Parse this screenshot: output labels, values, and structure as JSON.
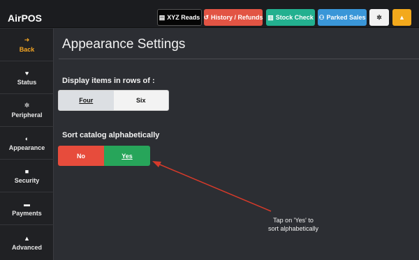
{
  "app": {
    "title": "AirPOS"
  },
  "toolbar": {
    "xyz": "XYZ Reads",
    "history": "History / Refunds",
    "stock": "Stock Check",
    "parked": "Parked Sales"
  },
  "sidebar": {
    "items": [
      {
        "label": "Back",
        "icon": "back-arrow-icon"
      },
      {
        "label": "Status",
        "icon": "heartbeat-icon"
      },
      {
        "label": "Peripheral",
        "icon": "gear-icon"
      },
      {
        "label": "Appearance",
        "icon": "contrast-icon"
      },
      {
        "label": "Security",
        "icon": "lock-icon"
      },
      {
        "label": "Payments",
        "icon": "cart-icon"
      },
      {
        "label": "Advanced",
        "icon": "warning-icon"
      }
    ]
  },
  "main": {
    "title": "Appearance Settings",
    "rows_label": "Display items in rows of :",
    "rows_options": [
      "Four",
      "Six"
    ],
    "rows_selected": "Four",
    "sort_label": "Sort catalog alphabetically",
    "sort_options": [
      "No",
      "Yes"
    ],
    "sort_selected": "Yes"
  },
  "annotation": {
    "line1": "Tap on 'Yes' to",
    "line2": "sort alphabetically"
  },
  "colors": {
    "accent": "#f5a623",
    "no": "#e74c3c",
    "yes": "#27a55a",
    "arrow": "#d63a2a"
  }
}
